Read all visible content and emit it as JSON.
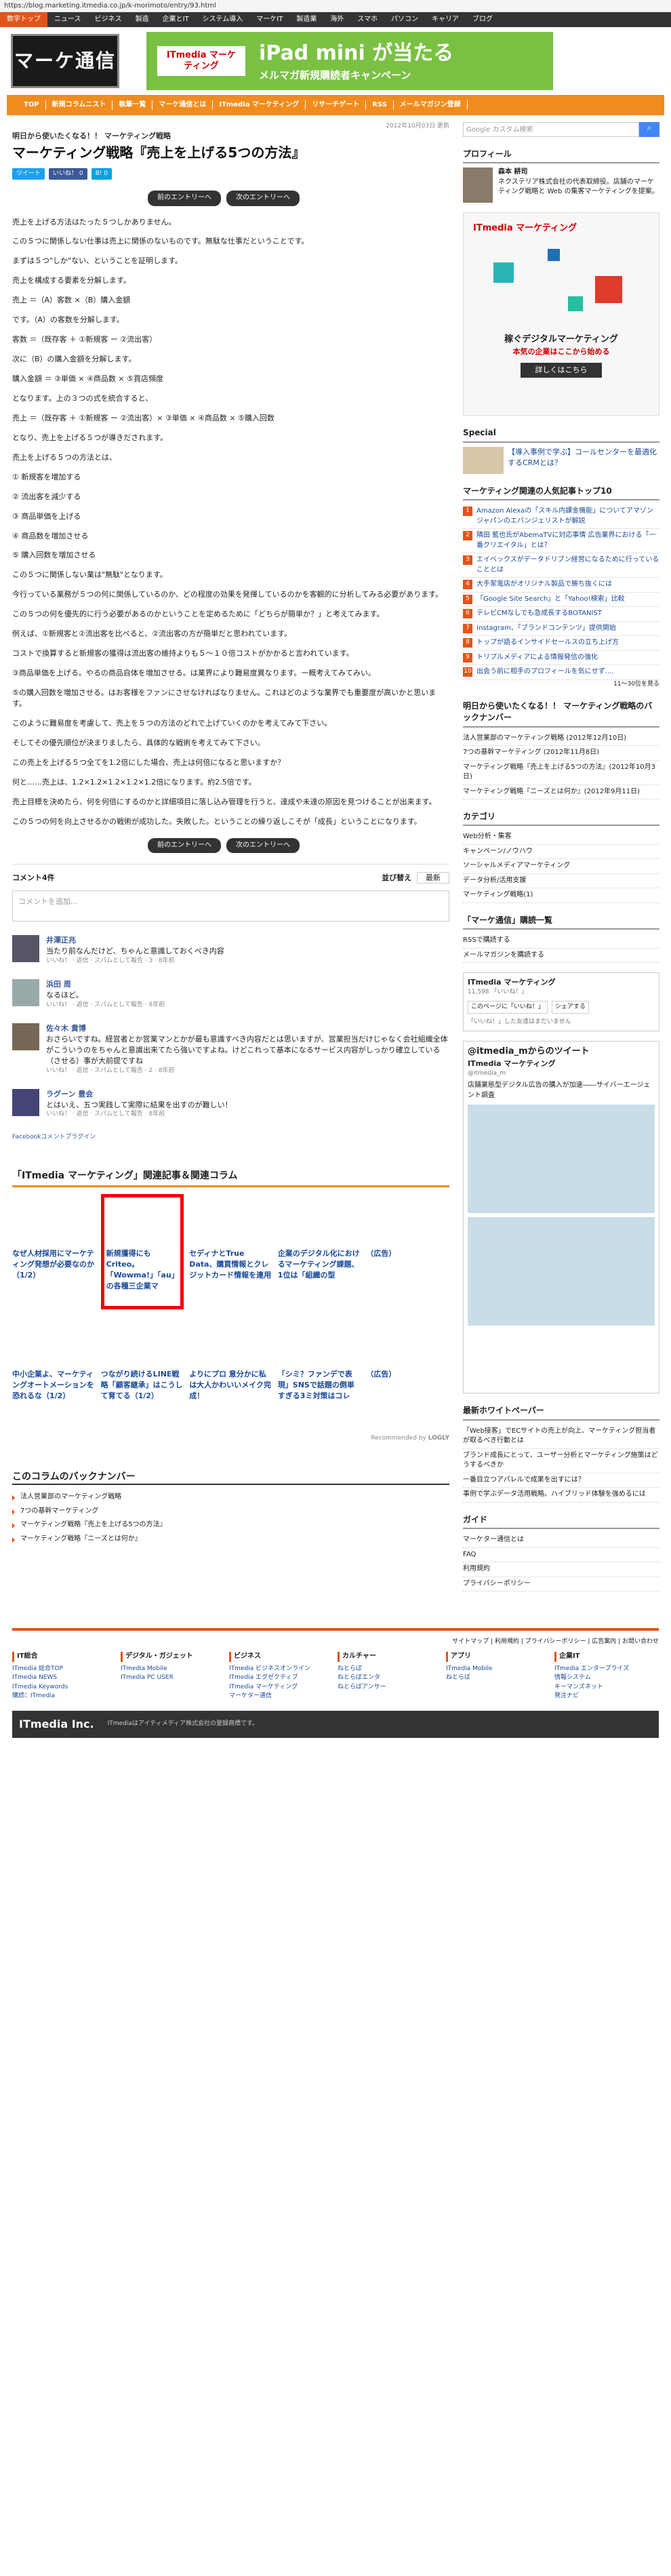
{
  "url": "https://blog.marketing.itmedia.co.jp/k-morimoto/entry/93.html",
  "top_nav": [
    "数字トップ",
    "ニュース",
    "ビジネス",
    "製造",
    "企業とIT",
    "システム導入",
    "マーケIT",
    "製造業",
    "海外",
    "スマホ",
    "パソコン",
    "キャリア",
    "ブログ"
  ],
  "logo_text": "マーケ通信",
  "banner": {
    "brand": "ITmedia マーケティング",
    "t1": "iPad mini が当たる",
    "t2": "メルマガ新規購読者キャンペーン"
  },
  "orange_nav": [
    "TOP",
    "新規コラムニスト",
    "執筆一覧",
    "マーケ通信とは",
    "ITmedia マーケティング",
    "リサーチゲート",
    "RSS",
    "メールマガジン登録"
  ],
  "date": "2012年10月03日 更新",
  "kicker": "明日から使いたくなる！！ マーケティング戦略",
  "title": "マーケティング戦略『売上を上げる5つの方法』",
  "share": {
    "tweet": "ツイート",
    "like": "いいね！ 0",
    "hatena": "B! 0"
  },
  "pager": {
    "prev": "前のエントリーへ",
    "next": "次のエントリーへ"
  },
  "body": [
    "売上を上げる方法はたった５つしかありません。",
    "この５つに関係しない仕事は売上に関係のないものです。無駄な仕事だということです。",
    "まずは５つ\"しか\"ない、ということを証明します。",
    "売上を構成する要素を分解します。",
    "売上 ＝（A）客数 ×（B）購入金額",
    "です。（A）の客数を分解します。",
    "客数 ＝（既存客 ＋ ①新規客 ー ②流出客）",
    "次に（B）の購入金額を分解します。",
    "購入金額 ＝ ③単価 × ④商品数 × ⑤買店頻度",
    "となります。上の３つの式を統合すると、",
    "売上 ＝（既存客 ＋ ①新規客 ー ②流出客）× ③単価 × ④商品数 × ⑤購入回数",
    "となり、売上を上げる５つが導きだされます。",
    "売上を上げる５つの方法とは、",
    "① 新規客を増加する",
    "② 流出客を減少する",
    "③ 商品単価を上げる",
    "④ 商品数を増加させる",
    "⑤ 購入回数を増加させる",
    "この５つに関係しない業は\"無駄\"となります。",
    "今行っている業務が５つの何に関係しているのか、どの程度の効果を発揮しているのかを客観的に分析してみる必要があります。",
    "この５つの何を優先的に行う必要があるのかということを定めるために「どちらが簡単か？」と考えてみます。",
    "例えば、①新規客と②流出客を比べると、②流出客の方が簡単だと思われています。",
    "コストで換算すると新規客の獲得は流出客の維持よりも５〜１０倍コストがかかると言われています。",
    "③商品単価を上げる。やるの商品自体を増加させる。は業界により難易度異なります。一概考えてみてみい。",
    "⑤の購入回数を増加させる。はお客様をファンにさせなければなりません。これはどのような業界でも重要度が高いかと思います。",
    "このように難易度を考慮して、売上を５つの方法のどれで上げていくのかを考えてみて下さい。",
    "そしてその優先順位が決まりましたら、具体的な戦術を考えてみて下さい。",
    "この売上を上げる５つ全てを1.2倍にした場合、売上は何倍になると思いますか？",
    "何と……売上は、1.2×1.2×1.2×1.2×1.2倍になります。約2.5倍です。",
    "売上目標を決めたら、何を何倍にするのかと詳細項目に落し込み管理を行うと、達成や未達の原因を見つけることが出来ます。",
    "この５つの何を向上させるかの戦術が成功した。失敗した。ということの繰り返しこそが「成長」ということになります。"
  ],
  "comments": {
    "count_label": "コメント4件",
    "sort_label": "並び替え",
    "sort_value": "最新",
    "placeholder": "コメントを追加...",
    "items": [
      {
        "name": "井澤正兆",
        "text": "当たり前なんだけど、ちゃんと意識しておくべき内容",
        "meta": "いいね！ · 返信 · スパムとして報告 · 3 · 8年前"
      },
      {
        "name": "浜田 周",
        "text": "なるほど。",
        "meta": "いいね！ · 返信 · スパムとして報告 · 8年前"
      },
      {
        "name": "佐々木 貴博",
        "text": "おさらいですね。経営者とか営業マンとかが最も意識すべき内容だとは思いますが、営業担当だけじゃなく会社組織全体がこういうのをちゃんと意識出来てたら強いですよね。けどこれって基本になるサービス内容がしっかり確立している（させる）事が大前提ですね",
        "meta": "いいね！ · 返信 · スパムとして報告 · 2 · 8年前"
      },
      {
        "name": "ラグーン 豊会",
        "text": "とはいえ、五つ実践して実際に結果を出すのが難しい！",
        "meta": "いいね！ · 返信 · スパムとして報告 · 8年前"
      }
    ],
    "plugin": "Facebookコメントプラグイン"
  },
  "related": {
    "title": "「ITmedia マーケティング」関連記事＆関連コラム",
    "row1": [
      "なぜ人材採用にマーケティング発想が必要なのか（1/2）",
      "新規獲得にもCriteo。「Wowma!」「au」の各種三企業マ",
      "セディナとTrue Data、購買情報とクレジットカード情報を連用",
      "企業のデジタル化におけるマーケティング課題、1位は「組織の型",
      "（広告）"
    ],
    "row2": [
      "中小企業よ、マーケティングオートメーションを恐れるな（1/2）",
      "つながり続けるLINE戦略「顧客継承」はこうして育てる（1/2）",
      "よりにプロ 意分かに私は大人かわいいメイク完成！",
      "「シミ？ファンデで表現」SNSで話題の倒単すぎる3ミ対策はコレ",
      "（広告）"
    ],
    "credit": "Recommended by",
    "credit_brand": "LOGLY"
  },
  "backnumber": {
    "title": "このコラムのバックナンバー",
    "items": [
      "法人営業部のマーケティング戦略",
      "7つの基幹マーケティング",
      "マーケティング戦略『売上を上げる5つの方法』",
      "マーケティング戦略『ニーズとは何か』"
    ]
  },
  "side": {
    "search_placeholder": "Google カスタム検索",
    "profile_title": "プロフィール",
    "profile_name": "森本 耕司",
    "profile_text": "ネクステリア株式会社の代表取締役。店舗のマーケティング戦略と Web の集客マーケティングを提案。",
    "ad_title": "ITmedia マーケティング",
    "ad_head": "稼ぐデジタルマーケティング",
    "ad_sub": "本気の企業はここから始める",
    "ad_link": "詳しくはこちら",
    "special_title": "Special",
    "special_text": "【導入事例で学ぶ】コールセンターを最適化するCRMとは？",
    "rank_title": "マーケティング関連の人気記事トップ10",
    "rank": [
      "Amazon Alexaの「スキル内課金機能」についてアマゾンジャパンのエバンジェリストが解説",
      "隣田 藍也氏がAbemaTVに対応事情 広告業界における「一番クリエイタル」とは？",
      "エイベックスがデータドリブン経営になるために行っていることとは",
      "大手家電店がオリジナル製品で勝ち抜くには",
      "「Google Site Search」と「Yahoo!検索」比較",
      "テレビCMなしでも急成長するBOTANIST",
      "Instagram、「ブランドコンテンツ」提供開始",
      "トップが語るインサイドセールスの立ち上げ方",
      "トリプルメディアによる情報発信の強化",
      "出会う前に相手のプロフィールを気にせず...."
    ],
    "rank_more": "11〜30位を見る",
    "series_title": "明日から使いたくなる！！ マーケティング戦略のバックナンバー",
    "series": [
      "法人営業部のマーケティング戦略 (2012年12月10日)",
      "7つの基幹マーケティング (2012年11月8日)",
      "マーケティング戦略『売上を上げる5つの方法』(2012年10月3日)",
      "マーケティング戦略『ニーズとは何か』(2012年9月11日)"
    ],
    "cat_title": "カテゴリ",
    "cats": [
      "Web分析・集客",
      "キャンペーン/ノウハウ",
      "ソーシャルメディアマーケティング",
      "データ分析/活用支援",
      "マーケティング戦略(1)"
    ],
    "sub_title": "「マーケ通信」購読一覧",
    "sub": [
      "RSSで購読する",
      "メールマガジンを購読する"
    ],
    "fb_title": "ITmedia マーケティング",
    "fb_likes": "11,598 「いいね！」",
    "fb_btn": "このページに「いいね！」",
    "fb_share": "シェアする",
    "fb_text": "「いいね！」した友達はまだいません",
    "tw_title": "@itmedia_mからのツイート",
    "tw_name": "ITmedia マーケティング",
    "tw_handle": "@itmedia_m",
    "tw_text": "店舗業態型デジタル広告の購入が加速――サイバーエージェント調査",
    "white_title": "最新ホワイトペーパー",
    "white": [
      "「Web接客」でECサイトの売上が向上、マーケティング担当者が取るべき行動とは",
      "ブランド成長にとって、ユーザー分析とマーケティング施策はどうするべきか",
      "一番目立つアパレルで成果を出すには？",
      "事例で学ぶデータ活用戦略。ハイブリッド体験を強めるには"
    ],
    "guide_title": "ガイド",
    "guide": [
      "マーケター通信とは",
      "FAQ",
      "利用規約",
      "プライバシーポリシー"
    ]
  },
  "footer": {
    "links": "サイトマップ | 利用規約 | プライバシーポリシー | 広告案内 | お問い合わせ",
    "cols": [
      {
        "title": "IT総合",
        "items": [
          "ITmedia 総合TOP",
          "ITmedia NEWS",
          "ITmedia Keywords",
          "購読：ITmedia"
        ]
      },
      {
        "title": "デジタル・ガジェット",
        "items": [
          "ITmedia Mobile",
          "ITmedia PC USER"
        ]
      },
      {
        "title": "ビジネス",
        "items": [
          "ITmedia ビジネスオンライン",
          "ITmedia エグゼクティブ",
          "ITmedia マーケティング",
          "マーケター通信"
        ]
      },
      {
        "title": "カルチャー",
        "items": [
          "ねとらぼ",
          "ねとらぼエンタ",
          "ねとらぼアンサー"
        ]
      },
      {
        "title": "アプリ",
        "items": [
          "ITmedia Mobile",
          "ねとらぼ"
        ]
      },
      {
        "title": "企業IT",
        "items": [
          "ITmedia エンタープライズ",
          "情報システム",
          "キーマンズネット",
          "発注ナビ"
        ]
      }
    ],
    "brand": "ITmedia Inc.",
    "brand_sub": "ITmediaはアイティメディア株式会社の登録商標です。"
  },
  "colors": {
    "accent": "#f08c1e",
    "brand": "#e2541a",
    "nav": "#333333"
  }
}
